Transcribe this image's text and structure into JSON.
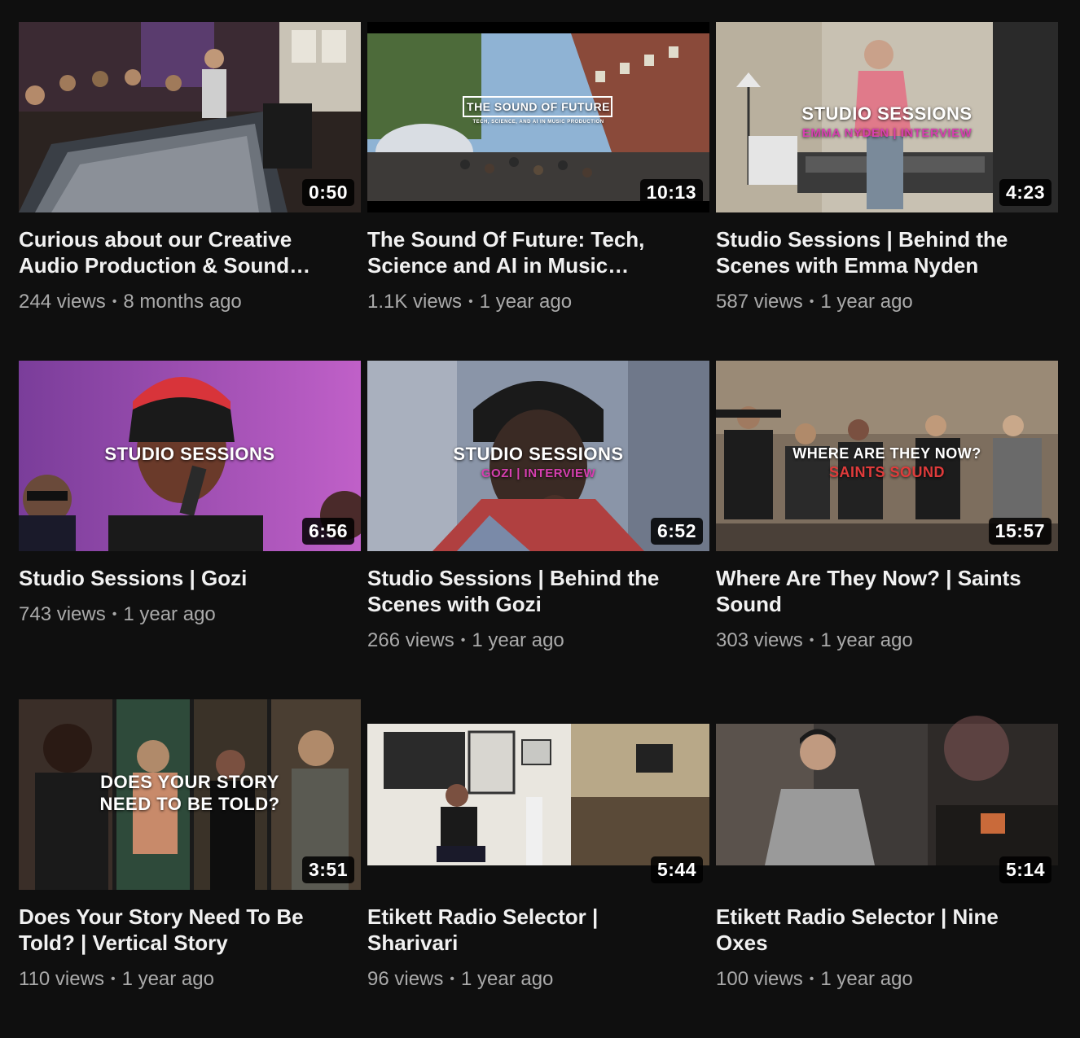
{
  "videos": [
    {
      "title": "Curious about our Creative Audio Production & Sound…",
      "views": "244 views",
      "age": "8 months ago",
      "duration": "0:50",
      "overlay": "",
      "overlay_sub": ""
    },
    {
      "title": "The Sound Of Future: Tech, Science and AI in Music…",
      "views": "1.1K views",
      "age": "1 year ago",
      "duration": "10:13",
      "overlay": "THE SOUND OF FUTURE",
      "overlay_sub": "TECH, SCIENCE, AND AI IN MUSIC PRODUCTION"
    },
    {
      "title": "Studio Sessions | Behind the Scenes with Emma Nyden",
      "views": "587 views",
      "age": "1 year ago",
      "duration": "4:23",
      "overlay": "STUDIO SESSIONS",
      "overlay_sub": "EMMA NYDEN | INTERVIEW"
    },
    {
      "title": "Studio Sessions | Gozi",
      "views": "743 views",
      "age": "1 year ago",
      "duration": "6:56",
      "overlay": "STUDIO SESSIONS",
      "overlay_sub": ""
    },
    {
      "title": "Studio Sessions | Behind the Scenes with Gozi",
      "views": "266 views",
      "age": "1 year ago",
      "duration": "6:52",
      "overlay": "STUDIO SESSIONS",
      "overlay_sub": "GOZI | INTERVIEW"
    },
    {
      "title": "Where Are They Now? | Saints Sound",
      "views": "303 views",
      "age": "1 year ago",
      "duration": "15:57",
      "overlay": "WHERE ARE THEY NOW?",
      "overlay_sub": "SAINTS SOUND"
    },
    {
      "title": "Does Your Story Need To Be Told? | Vertical Story",
      "views": "110 views",
      "age": "1 year ago",
      "duration": "3:51",
      "overlay": "DOES YOUR STORY\nNEED TO BE TOLD?",
      "overlay_sub": ""
    },
    {
      "title": "Etikett Radio Selector | Sharivari",
      "views": "96 views",
      "age": "1 year ago",
      "duration": "5:44",
      "overlay": "",
      "overlay_sub": ""
    },
    {
      "title": "Etikett Radio Selector | Nine Oxes",
      "views": "100 views",
      "age": "1 year ago",
      "duration": "5:14",
      "overlay": "",
      "overlay_sub": ""
    }
  ],
  "meta_separator": "•",
  "colors": {
    "background": "#0f0f0f",
    "title": "#f1f1f1",
    "meta": "#aaaaaa",
    "accent_pink": "#d63fb0"
  }
}
